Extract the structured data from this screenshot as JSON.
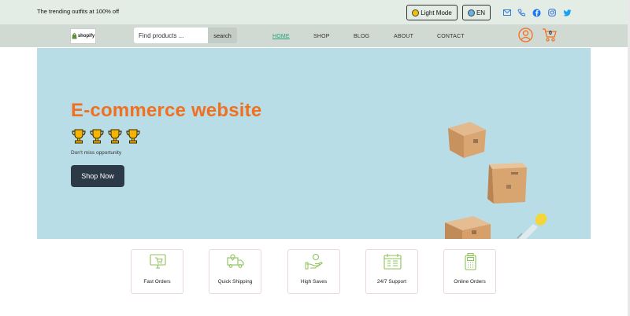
{
  "topbar": {
    "promo": "The trending outfits at 100% off",
    "theme_button": "Light Mode",
    "lang_button": "EN",
    "social_icons": [
      "mail-icon",
      "phone-icon",
      "facebook-icon",
      "instagram-icon",
      "twitter-icon"
    ]
  },
  "nav": {
    "logo_text": "shopify",
    "search": {
      "placeholder": "Find products ...",
      "value": "",
      "button": "search"
    },
    "links": [
      "HOME",
      "SHOP",
      "BLOG",
      "ABOUT",
      "CONTACT"
    ],
    "active_link": "HOME",
    "cart_count": "0"
  },
  "hero": {
    "title": "E-commerce website",
    "trophy_count": 4,
    "subtitle": "Don't miss opportunity",
    "cta": "Shop Now"
  },
  "features": [
    "Fast Orders",
    "Quick Shipping",
    "High Saves",
    "24/7 Support",
    "Online Orders"
  ],
  "colors": {
    "accent": "#f07022",
    "topbar_bg": "#e3ece5",
    "nav_bg": "#d1d9d3",
    "hero_bg": "#b9dde7",
    "button_dark": "#2c3a47",
    "nav_active": "#27a07a",
    "icon_green": "#8cc35a"
  }
}
